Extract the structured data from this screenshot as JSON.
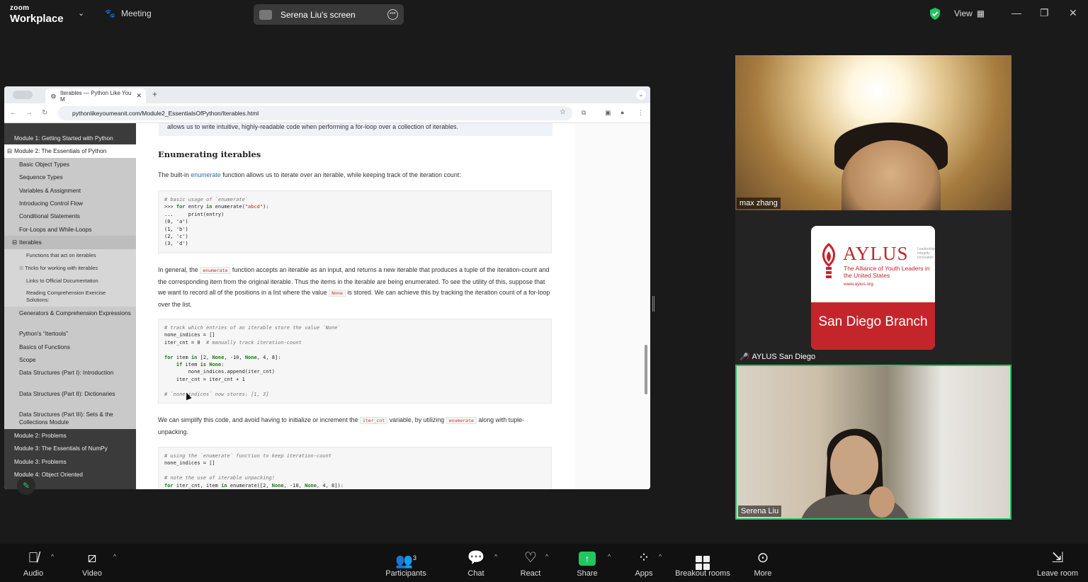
{
  "top_bar": {
    "brand_small": "zoom",
    "brand_large": "Workplace",
    "meeting_label": "Meeting",
    "screen_label": "Serena Liu's screen",
    "view_label": "View",
    "shield_color": "#22c55e"
  },
  "browser": {
    "tab_title": "Iterables — Python Like You M",
    "url": "pythonlikeyoumeanit.com/Module2_EssentialsOfPython/Iterables.html"
  },
  "sidebar": {
    "m1": "Module 1: Getting Started with Python",
    "m2": "Module 2: The Essentials of Python",
    "items": [
      "Basic Object Types",
      "Sequence Types",
      "Variables & Assignment",
      "Introducing Control Flow",
      "Conditional Statements",
      "For-Loops and While-Loops"
    ],
    "iterables": "Iterables",
    "sub": [
      "Functions that act on iterables",
      "Tricks for working with iterables",
      "Links to Official Documentation",
      "Reading Comprehension Exercise Solutions:"
    ],
    "items2": [
      "Generators & Comprehension Expressions",
      "Python's “Itertools”",
      "Basics of Functions",
      "Scope",
      "Data Structures (Part I): Introduction",
      "Data Structures (Part II): Dictionaries",
      "Data Structures (Part III): Sets & the Collections Module"
    ],
    "modules": [
      "Module 2: Problems",
      "Module 3: The Essentials of NumPy",
      "Module 3: Problems",
      "Module 4: Object Oriented"
    ]
  },
  "content": {
    "note": "allows us to write intuitive, highly-readable code when performing a for-loop over a collection of iterables.",
    "heading": "Enumerating iterables",
    "p1_pre": "The built-in ",
    "p1_link": "enumerate",
    "p1_post": " function allows us to iterate over an iterable, while keeping track of the iteration count:",
    "p2_a": "In general, the ",
    "p2_code": "enumerate",
    "p2_b": " function accepts an iterable as an input, and returns a new iterable that produces a tuple of the iteration-count and the corresponding item from the original iterable. Thus the items in the iterable are being enumerated. To see the utility of this, suppose that we want to record all of the positions in a list where the value ",
    "p2_code2": "None",
    "p2_c": " is stored. We can achieve this by tracking the iteration count of a for-loop over the list.",
    "p3_a": "We can simplify this code, and avoid having to initialize or increment the ",
    "p3_code": "iter_cnt",
    "p3_b": " variable, by utilizing ",
    "p3_code2": "enumerate",
    "p3_c": " along with tuple-unpacking."
  },
  "participants": {
    "max": "max zhang",
    "aylus": "AYLUS San Diego",
    "serena": "Serena Liu"
  },
  "aylus_logo": {
    "name": "AYLUS",
    "tagline": "Leadership Integrity Innovation",
    "sub": "The Alliance of Youth Leaders in the United States",
    "web": "www.aylus.org",
    "branch": "San Diego Branch",
    "red": "#c4252b"
  },
  "toolbar": {
    "audio": "Audio",
    "video": "Video",
    "participants": "Participants",
    "participants_count": "3",
    "chat": "Chat",
    "react": "React",
    "share": "Share",
    "apps": "Apps",
    "breakout": "Breakout rooms",
    "more": "More",
    "leave": "Leave room"
  }
}
